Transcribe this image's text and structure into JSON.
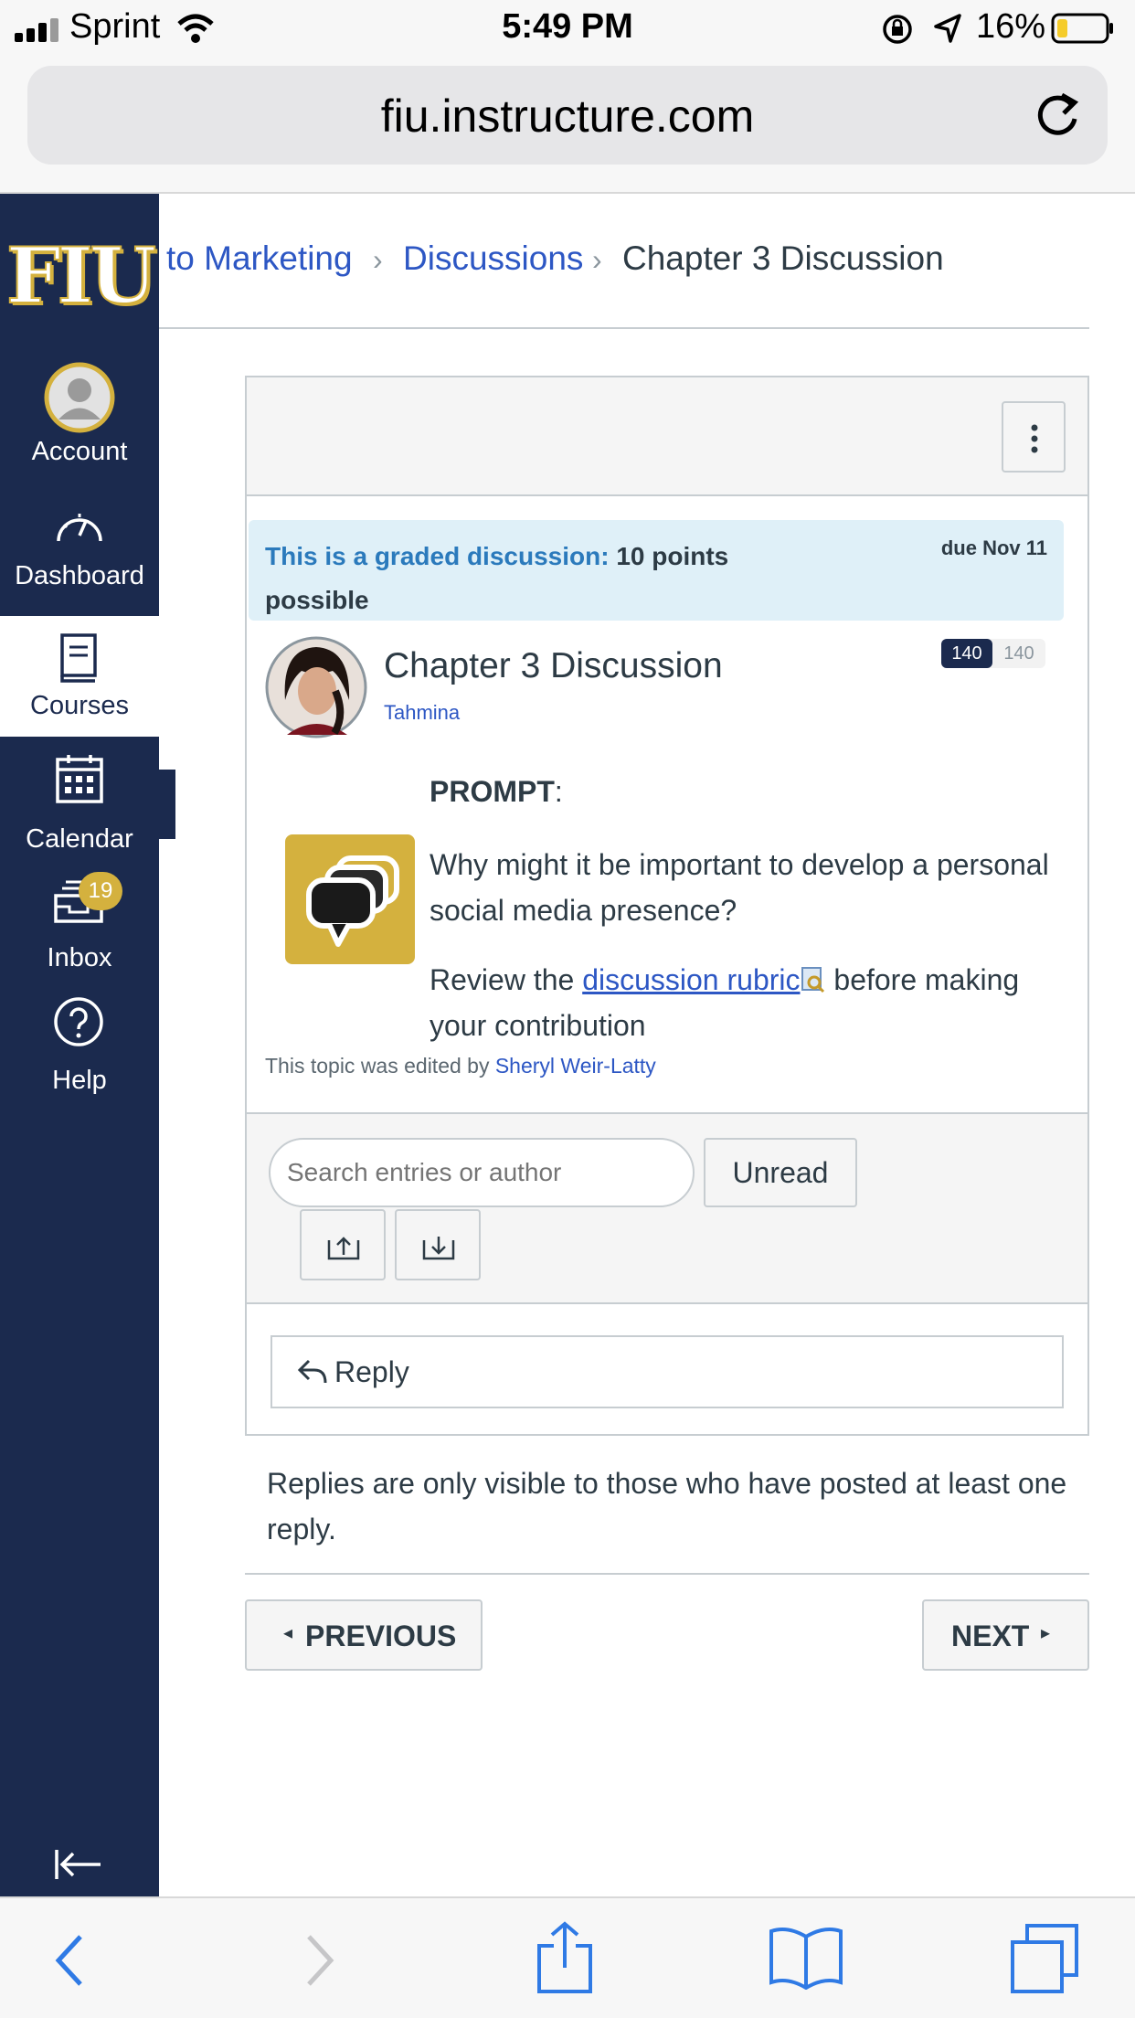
{
  "status_bar": {
    "carrier": "Sprint",
    "time": "5:49 PM",
    "battery": "16%"
  },
  "browser": {
    "url": "fiu.instructure.com"
  },
  "sidebar": {
    "logo": "FIU",
    "items": [
      {
        "label": "Account",
        "icon": "avatar-icon"
      },
      {
        "label": "Dashboard",
        "icon": "dashboard-icon"
      },
      {
        "label": "Courses",
        "icon": "book-icon"
      },
      {
        "label": "Calendar",
        "icon": "calendar-icon"
      },
      {
        "label": "Inbox",
        "icon": "inbox-icon",
        "badge": "19"
      },
      {
        "label": "Help",
        "icon": "help-icon"
      }
    ]
  },
  "breadcrumb": {
    "course": "to Marketing",
    "section": "Discussions",
    "current": "Chapter 3 Discussion"
  },
  "graded": {
    "label": "This is a graded discussion:",
    "points_value": "10",
    "points_suffix": "points possible",
    "due": "due Nov 11"
  },
  "topic": {
    "title": "Chapter 3 Discussion",
    "author": "Tahmina",
    "unread_count": "140",
    "total_count": "140",
    "prompt_label": "PROMPT",
    "prompt_colon": ":",
    "question": "Why might it be important to develop a personal social media presence?",
    "review_before": "Review the",
    "rubric_link": "discussion rubric",
    "review_after": "before making your contribution",
    "edited_by_label": "This topic was edited by",
    "edited_by_name": "Sheryl Weir-Latty"
  },
  "toolbar": {
    "search_placeholder": "Search entries or author",
    "unread_label": "Unread"
  },
  "reply": {
    "label": "Reply",
    "note": "Replies are only visible to those who have posted at least one reply."
  },
  "pager": {
    "previous": "PREVIOUS",
    "next": "NEXT"
  },
  "colors": {
    "sidebar": "#1b2a4e",
    "link": "#2d57c4",
    "fiu_gold": "#d4b13e",
    "graded_bg": "#dff0f8"
  }
}
